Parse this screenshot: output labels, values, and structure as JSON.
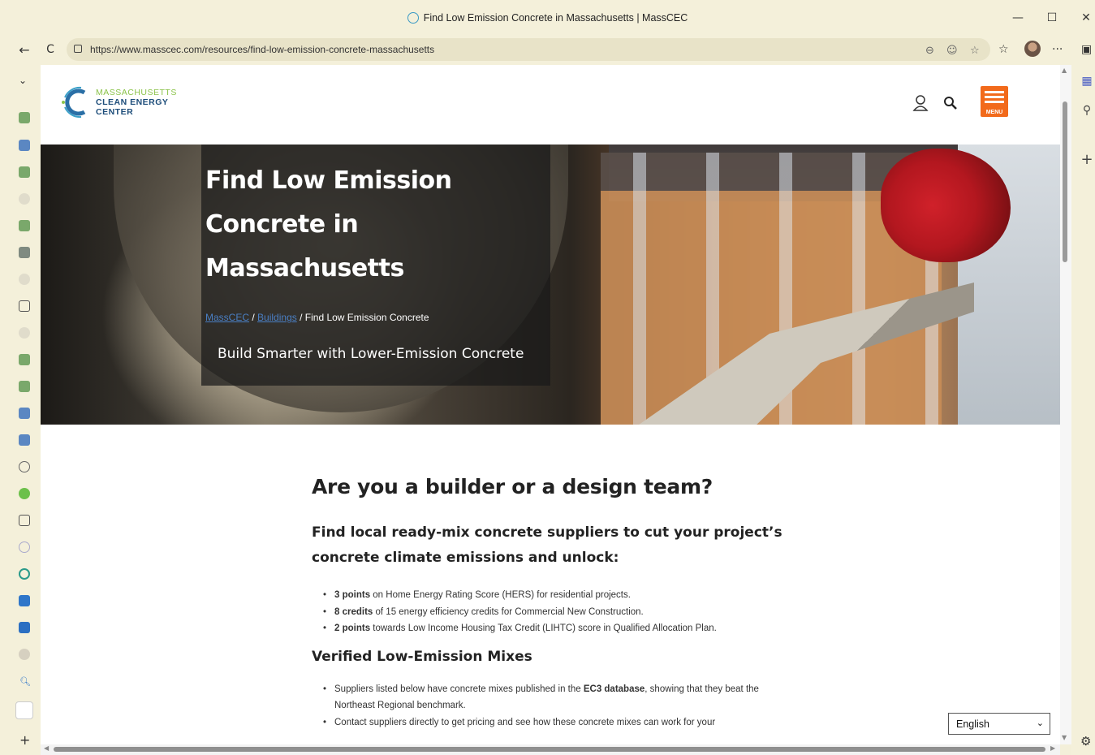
{
  "browser": {
    "tab_title": "Find Low Emission Concrete in Massachusetts | MassCEC",
    "url": "https://www.masscec.com/resources/find-low-emission-concrete-massachusetts",
    "minimize": "—",
    "maximize": "☐",
    "close": "✕",
    "back": "←",
    "reload": "C",
    "more": "···"
  },
  "site": {
    "logo_line1": "MASSACHUSETTS",
    "logo_line2": "CLEAN ENERGY",
    "logo_line3": "CENTER",
    "menu_label": "MENU"
  },
  "hero": {
    "title": "Find Low Emission Concrete in Massachusetts",
    "crumb_home": "MassCEC",
    "crumb_section": "Buildings",
    "crumb_current": "Find Low Emission Concrete",
    "sep": "/",
    "subtitle": "Build Smarter with Lower-Emission Concrete"
  },
  "content": {
    "heading": "Are you a builder or a design team?",
    "subheading": "Find local ready-mix concrete suppliers to cut your project’s concrete climate emissions and unlock:",
    "benefits": [
      {
        "bold": "3 points",
        "text": " on Home Energy Rating Score (HERS) for residential projects."
      },
      {
        "bold": "8 credits",
        "text": " of 15 energy efficiency credits for Commercial New Construction."
      },
      {
        "bold": "2 points",
        "text": " towards Low Income Housing Tax Credit (LIHTC) score in Qualified Allocation Plan."
      }
    ],
    "verified_heading": "Verified Low-Emission Mixes",
    "verified_bullets": [
      {
        "pre": "Suppliers listed below have concrete mixes published in the ",
        "bold": "EC3 database",
        "post": ", showing that they beat the Northeast Regional benchmark."
      },
      {
        "pre": "Contact suppliers directly to get pricing and see how these concrete mixes can work for your",
        "bold": "",
        "post": ""
      }
    ]
  },
  "language": {
    "selected": "English"
  }
}
